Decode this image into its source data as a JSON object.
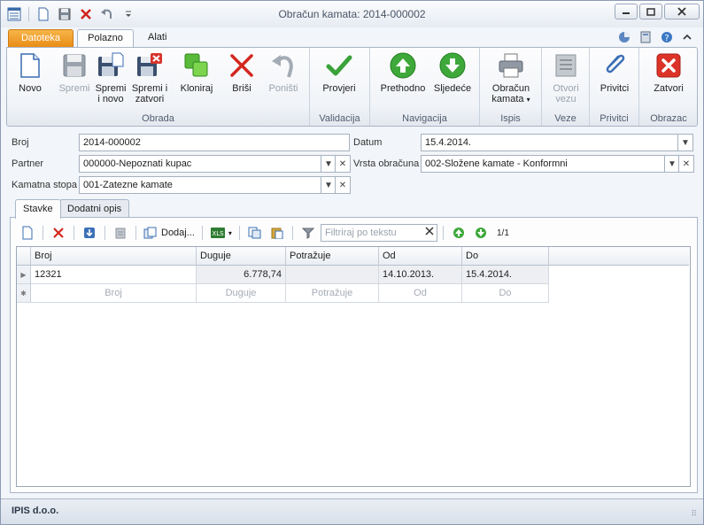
{
  "window": {
    "title": "Obračun kamata: 2014-000002"
  },
  "ribbon_tabs": {
    "file": "Datoteka",
    "home": "Polazno",
    "tools": "Alati"
  },
  "ribbon": {
    "groups": {
      "obrada": "Obrada",
      "validacija": "Validacija",
      "navigacija": "Navigacija",
      "ispis": "Ispis",
      "veze": "Veze",
      "privitci": "Privitci",
      "obrazac": "Obrazac"
    },
    "buttons": {
      "novo": "Novo",
      "spremi": "Spremi",
      "spremi_novo_1": "Spremi",
      "spremi_novo_2": "i novo",
      "spremi_zatvori_1": "Spremi i",
      "spremi_zatvori_2": "zatvori",
      "kloniraj": "Kloniraj",
      "brisi": "Briši",
      "ponisti": "Poništi",
      "provjeri": "Provjeri",
      "prethodno": "Prethodno",
      "sljedece": "Sljedeće",
      "obracun_1": "Obračun",
      "obracun_2": "kamata",
      "otvori_vezu_1": "Otvori",
      "otvori_vezu_2": "vezu",
      "privitci": "Privitci",
      "zatvori": "Zatvori"
    }
  },
  "form": {
    "broj_label": "Broj",
    "broj_value": "2014-000002",
    "datum_label": "Datum",
    "datum_value": "15.4.2014.",
    "partner_label": "Partner",
    "partner_value": "000000-Nepoznati kupac",
    "vrsta_label": "Vrsta obračuna",
    "vrsta_value": "002-Složene kamate - Konformni",
    "stopa_label": "Kamatna stopa",
    "stopa_value": "001-Zatezne kamate"
  },
  "inner_tabs": {
    "stavke": "Stavke",
    "opis": "Dodatni opis"
  },
  "grid_toolbar": {
    "dodaj": "Dodaj...",
    "filter_placeholder": "Filtriraj po tekstu",
    "pager": "1/1"
  },
  "grid": {
    "columns": [
      "Broj",
      "Duguje",
      "Potražuje",
      "Od",
      "Do"
    ],
    "rows": [
      {
        "broj": "12321",
        "duguje": "6.778,74",
        "potrazuje": "",
        "od": "14.10.2013.",
        "do": "15.4.2014."
      }
    ],
    "new_row_placeholders": [
      "Broj",
      "Duguje",
      "Potražuje",
      "Od",
      "Do"
    ]
  },
  "status": {
    "company": "IPIS d.o.o."
  }
}
